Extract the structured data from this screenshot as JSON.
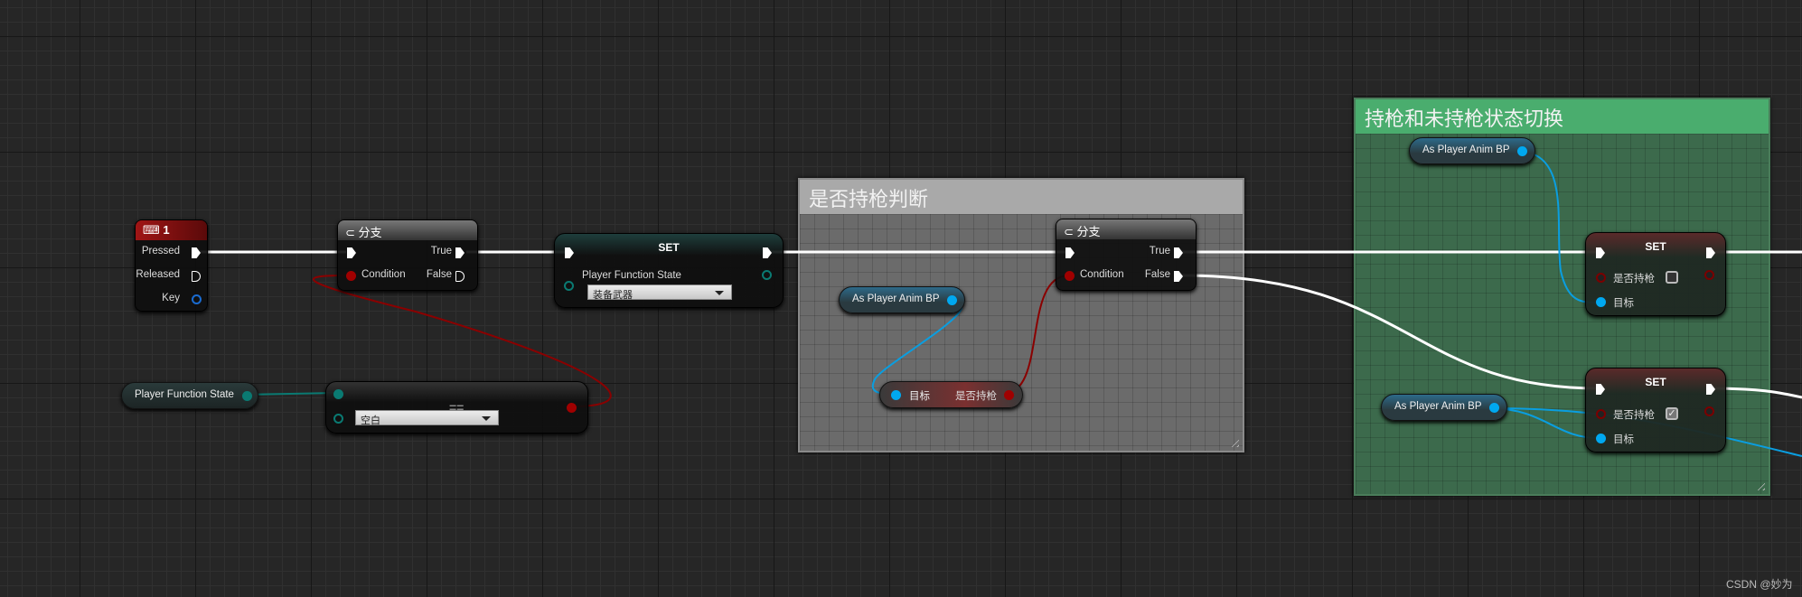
{
  "comments": [
    {
      "title": "是否持枪判断",
      "color": "#a9a9a9"
    },
    {
      "title": "持枪和未持枪状态切换",
      "color": "#4aad6e"
    }
  ],
  "key_event": {
    "title": "1",
    "pins": [
      "Pressed",
      "Released",
      "Key"
    ]
  },
  "branch1": {
    "title": "分支",
    "condition": "Condition",
    "true": "True",
    "false": "False"
  },
  "set1": {
    "title": "SET",
    "var": "Player Function State",
    "value": "装备武器"
  },
  "getter_pfs": {
    "label": "Player Function State"
  },
  "equals": {
    "op": "==",
    "value": "空白"
  },
  "getter_anim1": {
    "label": "As Player Anim BP"
  },
  "get_armed": {
    "target": "目标",
    "output": "是否持枪"
  },
  "branch2": {
    "title": "分支",
    "condition": "Condition",
    "true": "True",
    "false": "False"
  },
  "getter_anim2": {
    "label": "As Player Anim BP"
  },
  "set2": {
    "title": "SET",
    "var": "是否持枪",
    "checked": false,
    "target": "目标"
  },
  "getter_anim3": {
    "label": "As Player Anim BP"
  },
  "set3": {
    "title": "SET",
    "var": "是否持枪",
    "checked": true,
    "target": "目标"
  },
  "watermark": "CSDN @妙为",
  "colors": {
    "exec": "#ffffff",
    "bool": "#a00000",
    "object": "#00a8f0",
    "enum": "#0a6e6a"
  }
}
